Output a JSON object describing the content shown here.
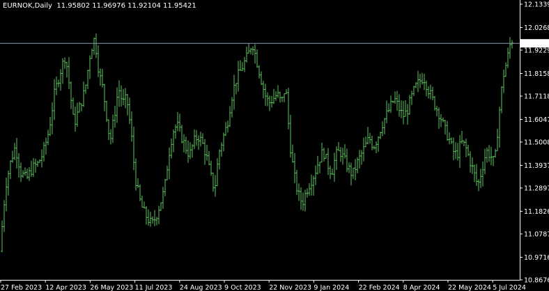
{
  "header": {
    "symbol": "EURNOK,Daily",
    "ohlc": "11.95802 11.96976 11.92104 11.95421"
  },
  "colors": {
    "background": "#000000",
    "bars": "#5cc45c",
    "axis": "#ffffff",
    "price_line": "#8c9bb4",
    "text": "#ffffff"
  },
  "chart_data": {
    "type": "ohlc",
    "title": "EURNOK,Daily",
    "last_price": 11.95421,
    "ylim": [
      10.86765,
      12.13395
    ],
    "y_ticks": [
      "12.13395",
      "12.02685",
      "11.92290",
      "11.81580",
      "11.71185",
      "11.60475",
      "11.50080",
      "11.39370",
      "11.28975",
      "11.18265",
      "11.07870",
      "10.97160",
      "10.86765"
    ],
    "x_ticks": [
      "27 Feb 2023",
      "12 Apr 2023",
      "26 May 2023",
      "11 Jul 2023",
      "24 Aug 2023",
      "9 Oct 2023",
      "22 Nov 2023",
      "9 Jan 2024",
      "22 Feb 2024",
      "8 Apr 2024",
      "22 May 2024",
      "5 Jul 2024"
    ],
    "grid": false,
    "series": [
      {
        "values": [
          [
            0,
            11.0
          ],
          [
            8,
            11.3
          ],
          [
            16,
            11.42
          ],
          [
            22,
            11.48
          ],
          [
            30,
            11.36
          ],
          [
            38,
            11.33
          ],
          [
            46,
            11.38
          ],
          [
            54,
            11.4
          ],
          [
            62,
            11.45
          ],
          [
            70,
            11.55
          ],
          [
            78,
            11.72
          ],
          [
            86,
            11.82
          ],
          [
            94,
            11.9
          ],
          [
            100,
            11.75
          ],
          [
            106,
            11.58
          ],
          [
            114,
            11.66
          ],
          [
            122,
            11.74
          ],
          [
            130,
            11.92
          ],
          [
            136,
            11.98
          ],
          [
            142,
            11.82
          ],
          [
            148,
            11.74
          ],
          [
            154,
            11.6
          ],
          [
            158,
            11.5
          ],
          [
            164,
            11.62
          ],
          [
            170,
            11.75
          ],
          [
            176,
            11.68
          ],
          [
            182,
            11.7
          ],
          [
            188,
            11.55
          ],
          [
            194,
            11.34
          ],
          [
            200,
            11.24
          ],
          [
            206,
            11.18
          ],
          [
            212,
            11.15
          ],
          [
            218,
            11.12
          ],
          [
            224,
            11.16
          ],
          [
            230,
            11.22
          ],
          [
            236,
            11.28
          ],
          [
            242,
            11.44
          ],
          [
            248,
            11.55
          ],
          [
            254,
            11.58
          ],
          [
            260,
            11.53
          ],
          [
            266,
            11.48
          ],
          [
            272,
            11.44
          ],
          [
            278,
            11.5
          ],
          [
            284,
            11.53
          ],
          [
            290,
            11.5
          ],
          [
            296,
            11.44
          ],
          [
            302,
            11.35
          ],
          [
            308,
            11.28
          ],
          [
            314,
            11.45
          ],
          [
            320,
            11.52
          ],
          [
            326,
            11.58
          ],
          [
            332,
            11.7
          ],
          [
            338,
            11.78
          ],
          [
            344,
            11.82
          ],
          [
            350,
            11.86
          ],
          [
            356,
            11.9
          ],
          [
            362,
            11.96
          ],
          [
            368,
            11.88
          ],
          [
            374,
            11.8
          ],
          [
            380,
            11.72
          ],
          [
            386,
            11.68
          ],
          [
            392,
            11.7
          ],
          [
            398,
            11.72
          ],
          [
            404,
            11.68
          ],
          [
            410,
            11.76
          ],
          [
            416,
            11.5
          ],
          [
            422,
            11.35
          ],
          [
            428,
            11.26
          ],
          [
            434,
            11.22
          ],
          [
            440,
            11.28
          ],
          [
            446,
            11.32
          ],
          [
            452,
            11.36
          ],
          [
            458,
            11.42
          ],
          [
            464,
            11.46
          ],
          [
            470,
            11.4
          ],
          [
            476,
            11.36
          ],
          [
            482,
            11.44
          ],
          [
            488,
            11.46
          ],
          [
            494,
            11.42
          ],
          [
            500,
            11.38
          ],
          [
            506,
            11.35
          ],
          [
            512,
            11.4
          ],
          [
            518,
            11.44
          ],
          [
            524,
            11.48
          ],
          [
            530,
            11.52
          ],
          [
            536,
            11.48
          ],
          [
            542,
            11.52
          ],
          [
            548,
            11.58
          ],
          [
            554,
            11.62
          ],
          [
            560,
            11.66
          ],
          [
            566,
            11.7
          ],
          [
            572,
            11.66
          ],
          [
            578,
            11.62
          ],
          [
            584,
            11.64
          ],
          [
            590,
            11.7
          ],
          [
            596,
            11.75
          ],
          [
            602,
            11.78
          ],
          [
            608,
            11.8
          ],
          [
            614,
            11.75
          ],
          [
            620,
            11.7
          ],
          [
            626,
            11.66
          ],
          [
            632,
            11.62
          ],
          [
            638,
            11.56
          ],
          [
            644,
            11.52
          ],
          [
            650,
            11.46
          ],
          [
            656,
            11.44
          ],
          [
            662,
            11.5
          ],
          [
            668,
            11.48
          ],
          [
            674,
            11.42
          ],
          [
            680,
            11.36
          ],
          [
            686,
            11.3
          ],
          [
            692,
            11.38
          ],
          [
            698,
            11.46
          ],
          [
            704,
            11.44
          ],
          [
            710,
            11.4
          ],
          [
            716,
            11.62
          ],
          [
            722,
            11.8
          ],
          [
            728,
            11.88
          ],
          [
            734,
            11.98
          ],
          [
            737,
            11.95
          ]
        ]
      }
    ]
  }
}
